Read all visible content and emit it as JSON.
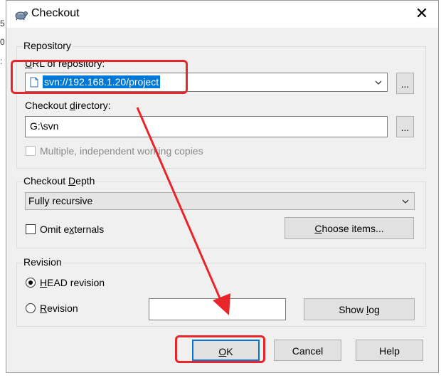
{
  "background": {
    "fragments": [
      "5",
      "0",
      ":"
    ]
  },
  "window": {
    "title": "Checkout",
    "close_glyph": "✕"
  },
  "repository": {
    "legend": "Repository",
    "url_label": "URL of repository:",
    "url_value": "svn://192.168.1.20/project",
    "browse_label": "...",
    "dir_label": "Checkout directory:",
    "dir_value": "G:\\svn",
    "dir_browse_label": "...",
    "multiple_label": "Multiple, independent working copies",
    "multiple_checked": false
  },
  "depth": {
    "legend": "Checkout Depth",
    "selected": "Fully recursive",
    "omit_label": "Omit externals",
    "omit_checked": false,
    "choose_label": "Choose items..."
  },
  "revision": {
    "legend": "Revision",
    "head_label": "HEAD revision",
    "head_selected": true,
    "rev_label": "Revision",
    "rev_value": "",
    "showlog_label": "Show log"
  },
  "buttons": {
    "ok": "OK",
    "cancel": "Cancel",
    "help": "Help"
  },
  "colors": {
    "annotation": "#e8262a",
    "selection": "#0078d7",
    "dialog_bg": "#f0f0f0"
  }
}
